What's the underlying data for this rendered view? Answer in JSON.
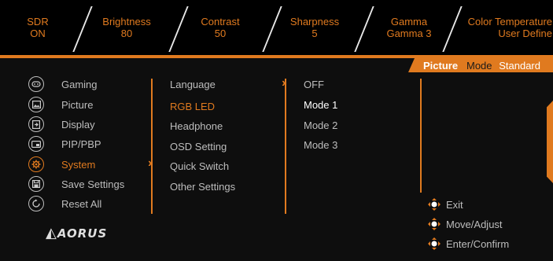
{
  "status_bar": [
    {
      "label": "SDR",
      "value": "ON"
    },
    {
      "label": "Brightness",
      "value": "80"
    },
    {
      "label": "Contrast",
      "value": "50"
    },
    {
      "label": "Sharpness",
      "value": "5"
    },
    {
      "label": "Gamma",
      "value": "Gamma 3"
    },
    {
      "label": "Color Temperature",
      "value": "User Define"
    }
  ],
  "picture_mode": {
    "word1": "Picture",
    "word2": "Mode",
    "value": "Standard"
  },
  "main_menu": [
    {
      "label": "Gaming",
      "icon": "gamepad-icon"
    },
    {
      "label": "Picture",
      "icon": "picture-icon"
    },
    {
      "label": "Display",
      "icon": "display-icon"
    },
    {
      "label": "PIP/PBP",
      "icon": "pip-icon"
    },
    {
      "label": "System",
      "icon": "gear-icon",
      "active": true
    },
    {
      "label": "Save Settings",
      "icon": "save-icon"
    },
    {
      "label": "Reset All",
      "icon": "reset-icon"
    }
  ],
  "submenu": [
    {
      "label": "Language"
    },
    {
      "label": "RGB LED",
      "active": true
    },
    {
      "label": "Headphone"
    },
    {
      "label": "OSD Setting"
    },
    {
      "label": "Quick Switch"
    },
    {
      "label": "Other Settings"
    }
  ],
  "options": [
    {
      "label": "OFF"
    },
    {
      "label": "Mode 1",
      "selected": true
    },
    {
      "label": "Mode 2"
    },
    {
      "label": "Mode 3"
    }
  ],
  "help": [
    {
      "label": "Exit"
    },
    {
      "label": "Move/Adjust"
    },
    {
      "label": "Enter/Confirm"
    }
  ],
  "logo": "AORUS",
  "colors": {
    "accent": "#e07a1f",
    "text": "#bdbdbd",
    "background": "#0b0b0b"
  }
}
